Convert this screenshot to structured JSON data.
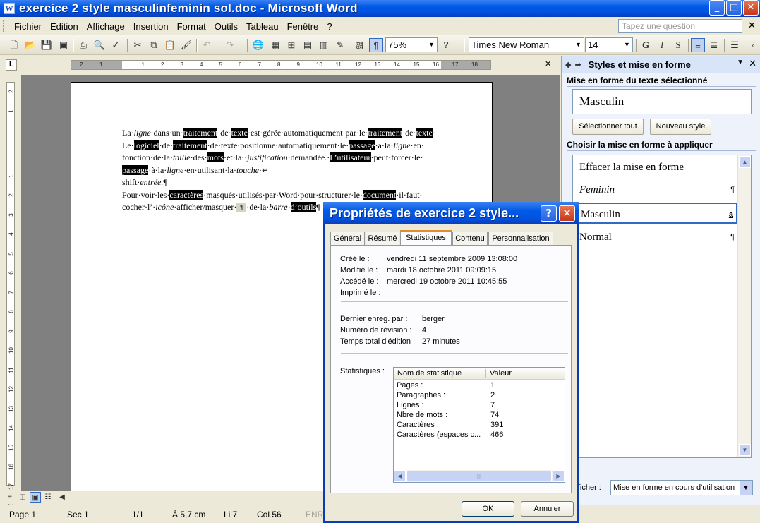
{
  "window": {
    "title": "exercice 2 style masculinfeminin sol.doc - Microsoft Word",
    "app_icon": "W"
  },
  "menu": {
    "items": [
      "Fichier",
      "Edition",
      "Affichage",
      "Insertion",
      "Format",
      "Outils",
      "Tableau",
      "Fenêtre",
      "?"
    ],
    "help_placeholder": "Tapez une question"
  },
  "toolbar": {
    "zoom": "75%",
    "font": "Times New Roman",
    "size": "14"
  },
  "ruler": {
    "h_labels": [
      "2",
      "1",
      "1",
      "2",
      "3",
      "4",
      "5",
      "6",
      "7",
      "8",
      "9",
      "10",
      "11",
      "12",
      "13",
      "14",
      "15",
      "16",
      "17",
      "18"
    ],
    "v_labels": [
      "2",
      "1",
      "1",
      "2",
      "3",
      "4",
      "5",
      "6",
      "7",
      "8",
      "9",
      "10",
      "11",
      "12",
      "13",
      "14",
      "15",
      "16",
      "17",
      "18"
    ]
  },
  "document": {
    "l1": [
      "La·",
      "ligne",
      "·dans·un·",
      "traitement",
      "·de·",
      "texte",
      "·est·gérée·automatiquement·par·le·",
      "traitement",
      "·de·",
      "texte",
      "·"
    ],
    "l2": [
      "Le·",
      "logiciel",
      "·de·",
      "traitement",
      "·de·texte·positionne·automatiquement·le·",
      "passage",
      "·à·la·",
      "ligne",
      "·en·"
    ],
    "l3": [
      "fonction·de·la·",
      "taille",
      "·des·",
      "mots",
      "·et·la··",
      "justification",
      "·demandée.·",
      "L’utilisateur",
      "·peut·forcer·le·"
    ],
    "l4": [
      "passage",
      "·à·la·",
      "ligne",
      "·en·utilisant·la·",
      "touche",
      "·↵"
    ],
    "l5": [
      "shift·",
      "entrée.",
      "¶"
    ],
    "l6": [
      "Pour·voir·les·",
      "caractères",
      "·masqués·utilisés·par·Word·pour·structurer·le·",
      "document",
      "·il·faut·"
    ],
    "l7": [
      "cocher·l’·",
      "icône",
      "·afficher/masquer·",
      "¶",
      "·de·la·",
      "barre",
      "·",
      "d’outils",
      "¶"
    ]
  },
  "status": {
    "page": "Page  1",
    "sec": "Sec  1",
    "pages": "1/1",
    "at": "À  5,7 cm",
    "li": "Li  7",
    "col": "Col  56",
    "enr": "ENR"
  },
  "taskpane": {
    "title": "Styles et mise en forme",
    "section1": "Mise en forme du texte sélectionné",
    "current_style": "Masculin",
    "btn_select_all": "Sélectionner tout",
    "btn_new_style": "Nouveau style",
    "section2": "Choisir la mise en forme à appliquer",
    "styles": [
      {
        "name": "Effacer la mise en forme",
        "mark": ""
      },
      {
        "name": "Feminin",
        "mark": "¶"
      },
      {
        "name": "Masculin",
        "mark": "a"
      },
      {
        "name": "Normal",
        "mark": "¶"
      }
    ],
    "show_label": "fficher :",
    "show_value": "Mise en forme en cours d'utilisation"
  },
  "dialog": {
    "title": "Propriétés de exercice 2 style...",
    "tabs": [
      "Général",
      "Résumé",
      "Statistiques",
      "Contenu",
      "Personnalisation"
    ],
    "active_tab": "Statistiques",
    "dates": [
      {
        "label": "Créé le :",
        "value": "vendredi 11 septembre 2009 13:08:00"
      },
      {
        "label": "Modifié le :",
        "value": "mardi 18 octobre 2011 09:09:15"
      },
      {
        "label": "Accédé le :",
        "value": "mercredi 19 octobre 2011 10:45:55"
      },
      {
        "label": "Imprimé le :",
        "value": ""
      }
    ],
    "info": [
      {
        "label": "Dernier enreg. par :",
        "value": "berger"
      },
      {
        "label": "Numéro de révision :",
        "value": "4"
      },
      {
        "label": "Temps total d'édition :",
        "value": "27 minutes"
      }
    ],
    "stats_label": "Statistiques :",
    "stats_headers": [
      "Nom de statistique",
      "Valeur"
    ],
    "stats_rows": [
      [
        "Pages :",
        "1"
      ],
      [
        "Paragraphes :",
        "2"
      ],
      [
        "Lignes :",
        "7"
      ],
      [
        "Nbre de mots :",
        "74"
      ],
      [
        "Caractères :",
        "391"
      ],
      [
        "Caractères (espaces c...",
        "466"
      ]
    ],
    "ok": "OK",
    "cancel": "Annuler"
  }
}
